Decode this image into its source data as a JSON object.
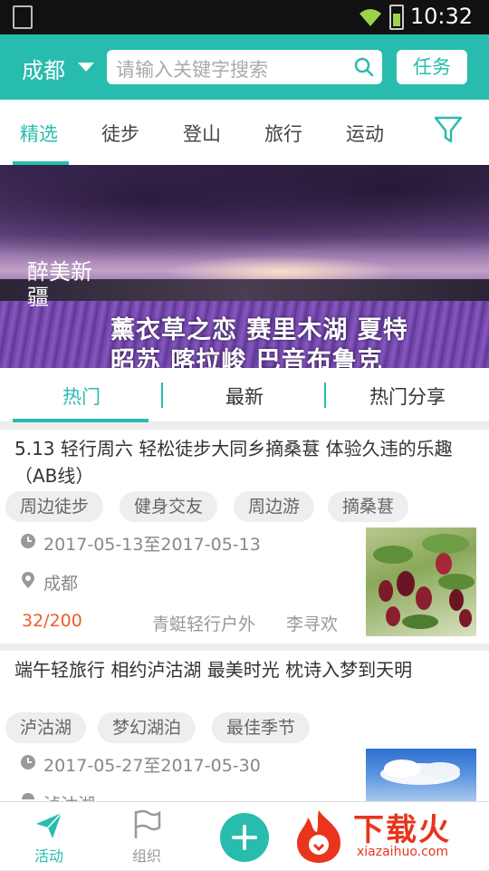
{
  "status_bar": {
    "time": "10:32"
  },
  "header": {
    "city": "成都",
    "search_placeholder": "请输入关键字搜索",
    "task_button": "任务"
  },
  "categories": [
    "精选",
    "徒步",
    "登山",
    "旅行",
    "运动"
  ],
  "banner": {
    "caption_line1": "薰衣草之恋 赛里木湖 夏特",
    "caption_line2": "昭苏 喀拉峻 巴音布鲁克",
    "logo_text": "醉美新疆"
  },
  "sub_tabs": [
    "热门",
    "最新",
    "热门分享"
  ],
  "activities": [
    {
      "title": "5.13 轻行周六 轻松徒步大同乡摘桑葚 体验久违的乐趣（AB线）",
      "tags": [
        "周边徒步",
        "健身交友",
        "周边游",
        "摘桑葚"
      ],
      "date": "2017-05-13至2017-05-13",
      "location": "成都",
      "count": "32/200",
      "organizer": "青蜓轻行户外",
      "leader": "李寻欢"
    },
    {
      "title": "端午轻旅行 相约泸沽湖 最美时光 枕诗入梦到天明",
      "tags": [
        "泸沽湖",
        "梦幻湖泊",
        "最佳季节"
      ],
      "date": "2017-05-27至2017-05-30",
      "location": "泸沽湖"
    }
  ],
  "bottom_nav": {
    "activity": "活动",
    "organization": "组织"
  },
  "watermark": {
    "brand": "下载火",
    "domain": "xiazaihuo.com"
  },
  "colors": {
    "accent": "#28bcae",
    "count": "#f05a28",
    "watermark": "#e8351c"
  }
}
